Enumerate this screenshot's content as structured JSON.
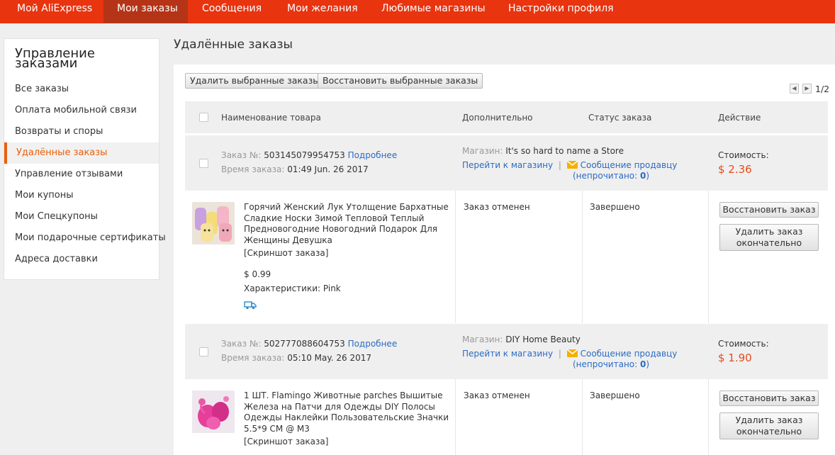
{
  "topnav": {
    "items": [
      "Мой AliExpress",
      "Мои заказы",
      "Сообщения",
      "Мои желания",
      "Любимые магазины",
      "Настройки профиля"
    ],
    "active_index": 1,
    "color": "#e8340f"
  },
  "sidebar": {
    "title": "Управление заказами",
    "items": [
      "Все заказы",
      "Оплата мобильной связи",
      "Возвраты и споры",
      "Удалённые заказы",
      "Управление отзывами",
      "Мои купоны",
      "Мои Спецкупоны",
      "Мои подарочные сертификаты",
      "Адреса доставки"
    ],
    "active_index": 3,
    "accent": "#e8600d"
  },
  "main": {
    "title": "Удалённые заказы",
    "delete_selected": "Удалить выбранные заказы",
    "restore_selected": "Восстановить выбранные заказы",
    "pagination": "1/2"
  },
  "table": {
    "headers": [
      "Наименование товара",
      "Дополнительно",
      "Статус заказа",
      "Действие"
    ]
  },
  "labels": {
    "order_no": "Заказ №:",
    "details": "Подробнее",
    "order_time": "Время заказа:",
    "store": "Магазин:",
    "go_to_store": "Перейти к магазину",
    "separator": "|",
    "message_seller": "Сообщение продавцу",
    "unread_open": "(непрочитано: ",
    "unread_close": ")",
    "cost": "Стоимость:",
    "screenshot": "[Скриншот заказа]",
    "restore": "Восстановить заказ",
    "delete_forever": "Удалить заказ окончательно",
    "characteristics": "Характеристики:"
  },
  "orders": [
    {
      "number": "503145079954753",
      "time": "01:49 Jun. 26 2017",
      "store": "It's so hard to name a Store",
      "unread": "0",
      "cost": "$ 2.36",
      "product": "Горячий Женский Лук Утолщение Бархатные Сладкие Носки Зимой Тепловой Теплый Предновогодние Новогодний Подарок Для Женщины Девушка",
      "item_price": "$ 0.99",
      "characteristic": "Pink",
      "extra": "Заказ отменен",
      "status": "Завершено"
    },
    {
      "number": "502777088604753",
      "time": "05:10 May. 26 2017",
      "store": "DIY Home Beauty",
      "unread": "0",
      "cost": "$ 1.90",
      "product": "1 ШТ. Flamingo Животные parches Вышитые Железа на Патчи для Одежды DIY Полосы Одежды Наклейки Пользовательские Значки 5.5*9 CM @ M3",
      "extra": "Заказ отменен",
      "status": "Завершено"
    }
  ]
}
